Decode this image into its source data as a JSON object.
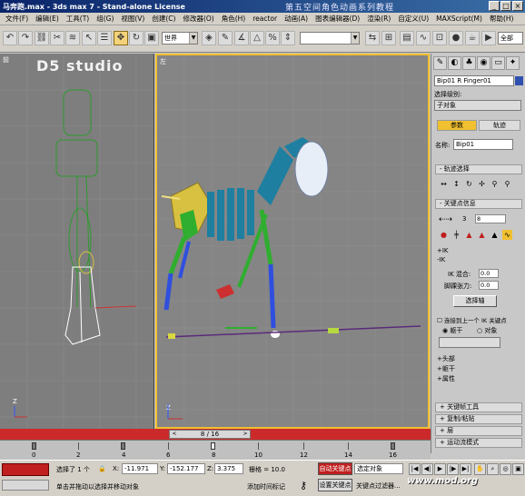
{
  "title": {
    "app": "马奔跑.max - 3ds max 7 - Stand-alone License",
    "course": "第五空间角色动画系列教程"
  },
  "menu": [
    "文件(F)",
    "编辑(E)",
    "工具(T)",
    "组(G)",
    "视图(V)",
    "创建(C)",
    "修改器(O)",
    "角色(H)",
    "reactor",
    "动画(A)",
    "图表编辑器(D)",
    "渲染(R)",
    "自定义(U)",
    "MAXScript(M)",
    "帮助(H)"
  ],
  "toolbar": {
    "coord_system": "世界",
    "named_selection": "",
    "extra_button": "全部"
  },
  "viewports": {
    "left_label": "前",
    "main_label": "左",
    "watermark": "D5 studio"
  },
  "panel": {
    "object_name": "Bip01 R Finger01",
    "selection_level_label": "选择级别:",
    "sub_object_label": "子对象",
    "tabs": {
      "params": "参数",
      "track": "轨迹"
    },
    "name_label": "名称:",
    "name_value": "Bip01",
    "rollouts": {
      "track_select": "轨迹选择",
      "key_info": "关键点信息",
      "key_tools": "关键帧工具",
      "copy_paste": "复制/粘贴",
      "layers": "层",
      "motion_flow": "运动流模式"
    },
    "key_number": "3",
    "key_value": "8",
    "ik_label": "+IK",
    "ik2_label": "-IK",
    "ik_blend_label": "IK 混合:",
    "ik_blend_value": "0.0",
    "ankle_tension_label": "脚踝张力:",
    "ankle_tension_value": "0.0",
    "select_pivot_button": "选择轴",
    "join_prev_label": "连接到上一个 IK 关键点",
    "body_label": "躯干",
    "object_label": "对象",
    "head_label": "+头部",
    "trunk_label": "+躯干",
    "props_label": "+属性"
  },
  "timeslider": {
    "frame": "8 / 16",
    "prev": "<",
    "next": ">"
  },
  "trackbar": {
    "ticks": [
      "0",
      "2",
      "4",
      "6",
      "8",
      "10",
      "12",
      "14",
      "16"
    ]
  },
  "status": {
    "selected": "选择了 1 个",
    "x": "-11.971",
    "y": "-152.177",
    "z": "3.375",
    "grid": "栅格 = 10.0",
    "prompt": "单击并拖动以选择并移动对象",
    "add_time_tag": "添加时间标记",
    "auto_key": "自动关键点",
    "selected_set": "选定对象",
    "set_key": "设置关键点",
    "key_filter": "关键点过滤器...",
    "brand": "www.mod.org"
  },
  "colors": {
    "title_bg": "#0a246a",
    "timeslider": "#cc2a2a",
    "autokey": "#c02020",
    "active_tab": "#f0c030"
  }
}
